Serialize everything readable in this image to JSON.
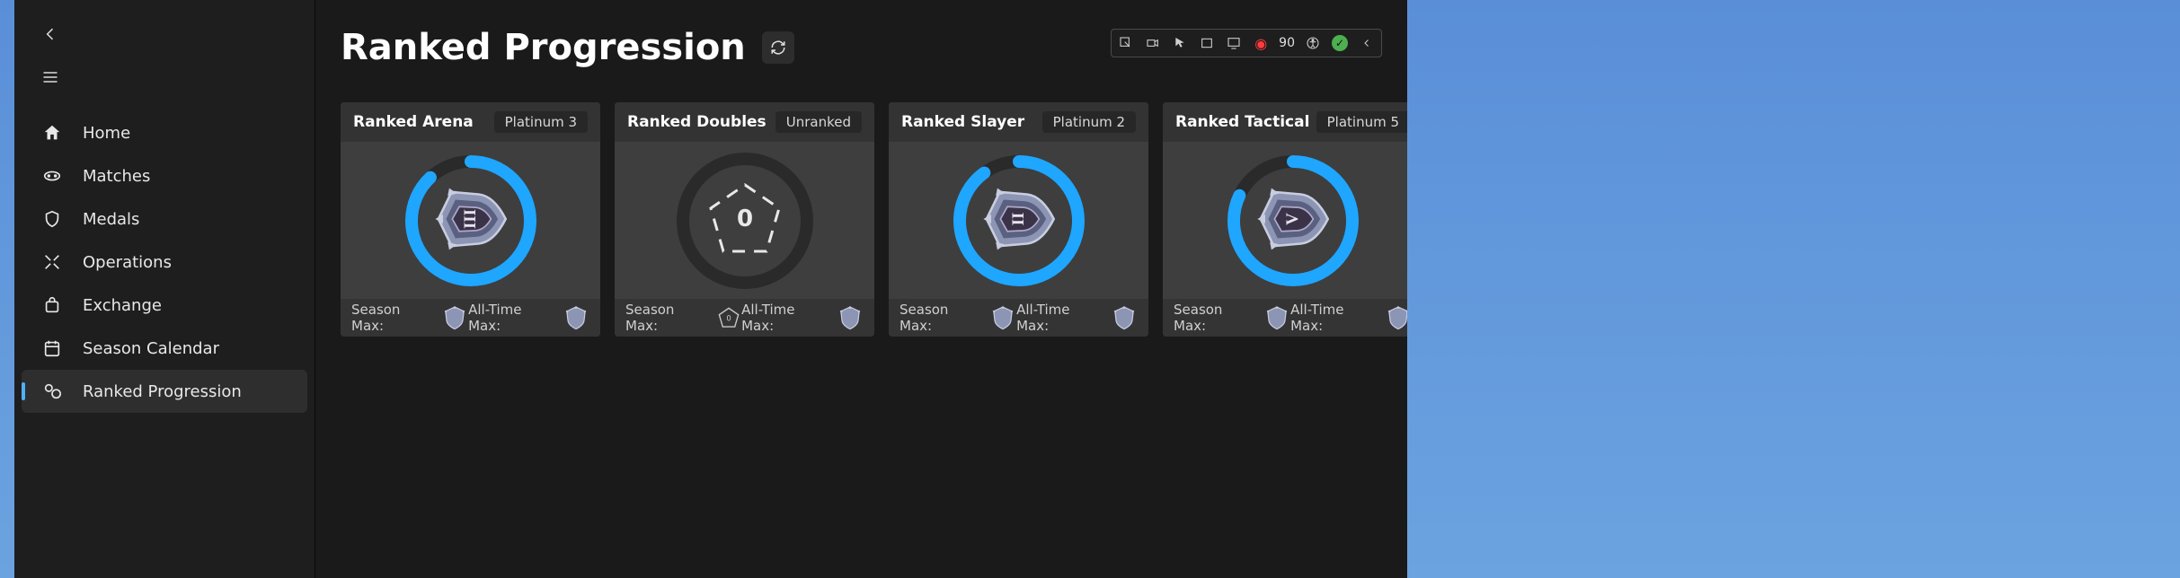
{
  "page": {
    "title": "Ranked Progression"
  },
  "sidebar": {
    "items": [
      {
        "label": "Home"
      },
      {
        "label": "Matches"
      },
      {
        "label": "Medals"
      },
      {
        "label": "Operations"
      },
      {
        "label": "Exchange"
      },
      {
        "label": "Season Calendar"
      },
      {
        "label": "Ranked Progression"
      }
    ]
  },
  "toolbar": {
    "record_value": "90"
  },
  "cards": [
    {
      "title": "Ranked Arena",
      "rank_label": "Platinum 3",
      "tier_numeral": "III",
      "progress_pct": 88,
      "ranked": true,
      "season_max_label": "Season Max:",
      "alltime_max_label": "All-Time Max:"
    },
    {
      "title": "Ranked Doubles",
      "rank_label": "Unranked",
      "tier_numeral": "0",
      "progress_pct": 0,
      "ranked": false,
      "season_max_label": "Season Max:",
      "alltime_max_label": "All-Time Max:"
    },
    {
      "title": "Ranked Slayer",
      "rank_label": "Platinum 2",
      "tier_numeral": "II",
      "progress_pct": 90,
      "ranked": true,
      "season_max_label": "Season Max:",
      "alltime_max_label": "All-Time Max:"
    },
    {
      "title": "Ranked Tactical",
      "rank_label": "Platinum 5",
      "tier_numeral": "V",
      "progress_pct": 82,
      "ranked": true,
      "season_max_label": "Season Max:",
      "alltime_max_label": "All-Time Max:"
    }
  ],
  "colors": {
    "accent": "#1fa6ff",
    "shield_light": "#c8cde0",
    "shield_mid": "#8d95b5",
    "shield_dark": "#5a6180",
    "shield_inner": "#3a3348"
  }
}
